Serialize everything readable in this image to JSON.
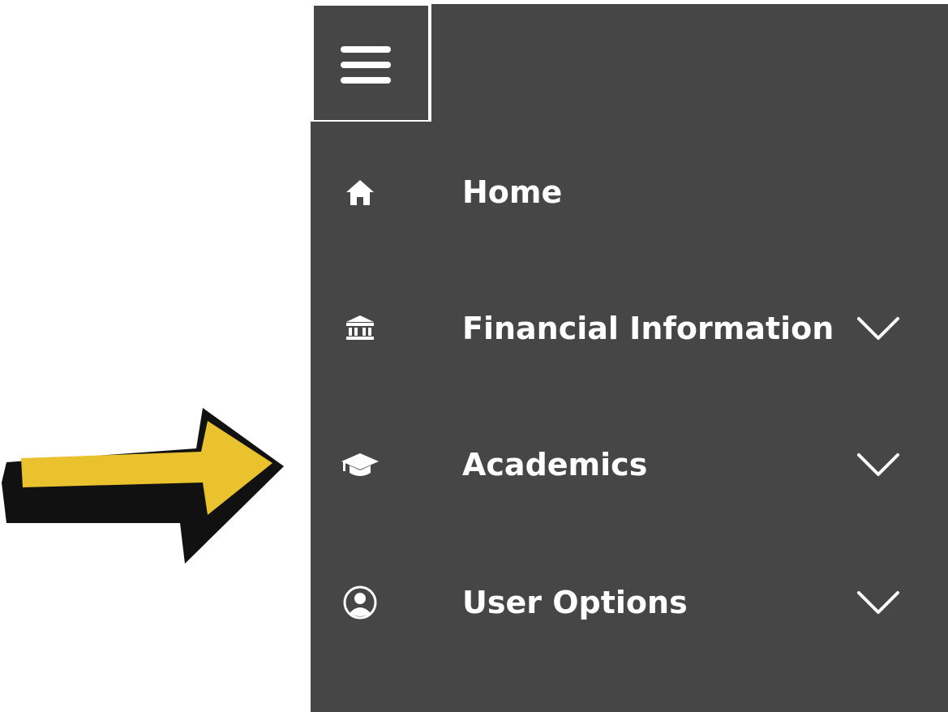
{
  "menu": {
    "toggle_icon": "hamburger-menu-icon",
    "items": [
      {
        "label": "Home",
        "icon": "home-icon",
        "expandable": false
      },
      {
        "label": "Financial Information",
        "icon": "bank-icon",
        "expandable": true,
        "chevron_icon": "chevron-down-icon"
      },
      {
        "label": "Academics",
        "icon": "graduation-cap-icon",
        "expandable": true,
        "chevron_icon": "chevron-down-icon"
      },
      {
        "label": "User Options",
        "icon": "user-circle-icon",
        "expandable": true,
        "chevron_icon": "chevron-down-icon"
      }
    ]
  },
  "annotation": {
    "arrow_icon": "pointer-arrow-icon",
    "points_to": "Academics",
    "fill_color": "#E9C22E",
    "outline_color": "#111111"
  },
  "colors": {
    "panel_background": "#464646",
    "text": "#ffffff",
    "page_background": "#ffffff"
  }
}
